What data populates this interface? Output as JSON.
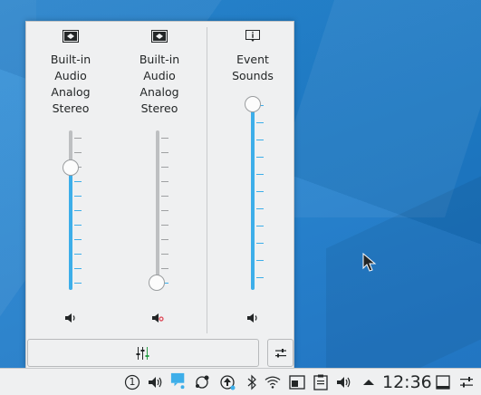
{
  "popup": {
    "channels": [
      {
        "name_lines": [
          "Built-in",
          "Audio",
          "Analog",
          "Stereo"
        ],
        "volume": 0.75,
        "muted": false,
        "device_icon": "speaker-device-icon"
      },
      {
        "name_lines": [
          "Built-in",
          "Audio",
          "Analog",
          "Stereo"
        ],
        "volume": 0.0,
        "muted": true,
        "device_icon": "speaker-device-icon"
      },
      {
        "name_lines": [
          "Event",
          "Sounds"
        ],
        "volume": 1.0,
        "muted": false,
        "device_icon": "info-icon"
      }
    ]
  },
  "panel": {
    "clock": "12:36",
    "tray_icons": [
      "notifications-icon",
      "volume-icon",
      "chat-icon",
      "kde-connect-icon",
      "updates-icon",
      "bluetooth-icon",
      "wifi-icon",
      "vault-icon",
      "clipboard-icon",
      "volume-icon",
      "show-hidden-icon",
      "show-desktop-icon",
      "panel-settings-icon"
    ],
    "notification_badge": "1"
  },
  "colors": {
    "accent": "#3daee9",
    "panel_bg": "#eff0f1",
    "desktop": "#1d7fcb",
    "muted": "#da4453"
  }
}
